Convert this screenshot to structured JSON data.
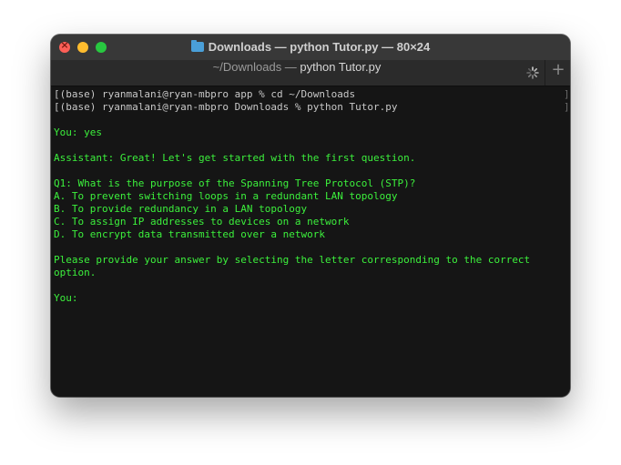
{
  "window": {
    "title": "Downloads — python Tutor.py — 80×24",
    "tab_dim": "~/Downloads — ",
    "tab_strong": "python Tutor.py"
  },
  "terminal": {
    "lines": [
      "[(base) ryanmalani@ryan-mbpro app % cd ~/Downloads",
      "[(base) ryanmalani@ryan-mbpro Downloads % python Tutor.py",
      "",
      "You: yes",
      "",
      "Assistant: Great! Let's get started with the first question.",
      "",
      "Q1: What is the purpose of the Spanning Tree Protocol (STP)?",
      "A. To prevent switching loops in a redundant LAN topology",
      "B. To provide redundancy in a LAN topology",
      "C. To assign IP addresses to devices on a network",
      "D. To encrypt data transmitted over a network",
      "",
      "Please provide your answer by selecting the letter corresponding to the correct",
      "option.",
      "",
      "You:"
    ],
    "right_bracket": "]"
  },
  "colors": {
    "terminal_bg": "#151515",
    "output_text": "#3cf03c",
    "prompt_text": "#c8c8c8",
    "titlebar": "#383838"
  },
  "icons": {
    "folder": "folder-icon",
    "spinner": "activity-spinner-icon",
    "new_tab": "plus-icon"
  }
}
